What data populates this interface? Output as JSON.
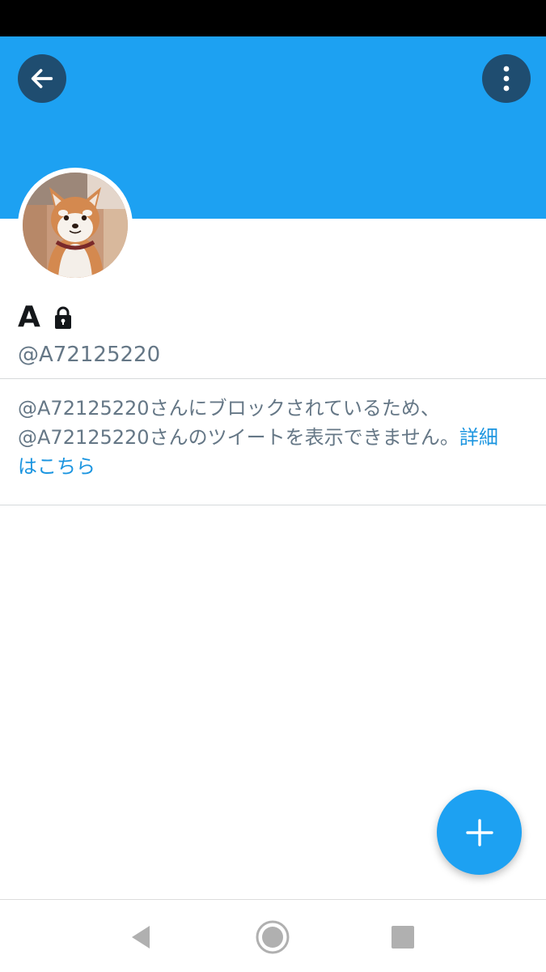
{
  "profile": {
    "display_name": "A",
    "handle": "@A72125220",
    "protected": true
  },
  "icons": {
    "back": "arrow-left-icon",
    "menu": "more-vertical-icon",
    "lock": "lock-icon",
    "compose": "plus-icon",
    "avatar": "shiba-dog-avatar"
  },
  "notice": {
    "line1": "@A72125220さんにブロックされているため、",
    "line2": "@A72125220さんのツイートを表示できません。",
    "link_part1": "詳細",
    "link_part2": "はこちら"
  },
  "system_nav": {
    "back": "triangle-back-icon",
    "home": "circle-home-icon",
    "recents": "square-recents-icon"
  },
  "colors": {
    "banner": "#1da1f2",
    "header_button": "#1f4d70",
    "link": "#1b95e0",
    "secondary_text": "#657786",
    "primary_text": "#14171a"
  }
}
